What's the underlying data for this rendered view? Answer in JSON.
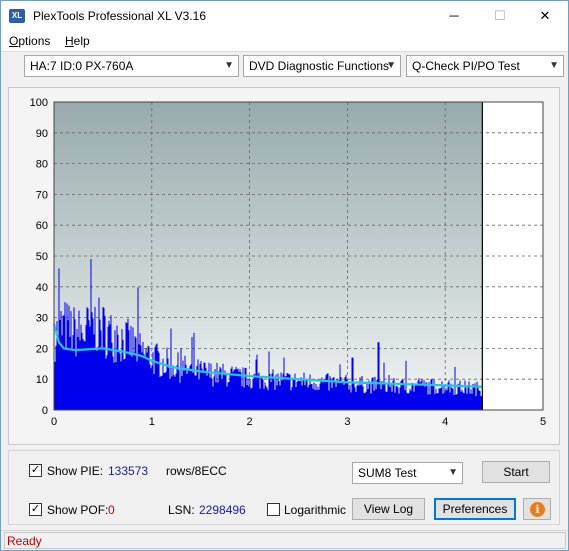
{
  "window": {
    "title": "PlexTools Professional XL V3.16",
    "icon_text": "XL"
  },
  "titlebar_buttons": {
    "minimize": "─",
    "maximize": "☐",
    "close": "✕"
  },
  "menu": [
    {
      "label": "Options",
      "underline": "O",
      "rest": "ptions"
    },
    {
      "label": "Help",
      "underline": "H",
      "rest": "elp"
    }
  ],
  "toolbar": {
    "drive_select": "HA:7 ID:0  PX-760A",
    "function_select": "DVD Diagnostic Functions",
    "test_select": "Q-Check PI/PO Test"
  },
  "chart_data": {
    "type": "area",
    "xlim": [
      0,
      5
    ],
    "ylim": [
      0,
      100
    ],
    "x_ticks": [
      "0",
      "1",
      "2",
      "3",
      "4",
      "5"
    ],
    "y_ticks": [
      "0",
      "10",
      "20",
      "30",
      "40",
      "50",
      "60",
      "70",
      "80",
      "90",
      "100"
    ],
    "grid": true,
    "end_marker_x": 4.38,
    "series": [
      {
        "style": "bars",
        "color": "#0000ee",
        "x": [
          0.0,
          0.1,
          0.2,
          0.3,
          0.4,
          0.5,
          0.6,
          0.7,
          0.8,
          0.9,
          1.0,
          1.2,
          1.4,
          1.6,
          1.8,
          2.0,
          2.5,
          3.0,
          3.5,
          4.0,
          4.38
        ],
        "values": [
          28,
          32,
          30,
          29,
          33,
          31,
          28,
          27,
          25,
          22,
          20,
          17,
          15,
          14,
          13,
          12,
          11,
          10,
          9,
          9,
          8
        ],
        "peaks": [
          {
            "x": 0.05,
            "y": 46
          },
          {
            "x": 0.38,
            "y": 49
          },
          {
            "x": 1.3,
            "y": 20
          },
          {
            "x": 2.2,
            "y": 19
          },
          {
            "x": 3.05,
            "y": 17
          },
          {
            "x": 3.32,
            "y": 22
          },
          {
            "x": 3.6,
            "y": 16
          },
          {
            "x": 4.1,
            "y": 14
          }
        ]
      },
      {
        "style": "line",
        "color": "#1ec8e8",
        "x": [
          0.0,
          0.05,
          0.1,
          0.2,
          0.3,
          0.5,
          0.7,
          0.9,
          1.0,
          1.2,
          1.5,
          2.0,
          2.5,
          3.0,
          3.5,
          4.0,
          4.38
        ],
        "values": [
          28,
          22,
          20,
          19.5,
          19.6,
          20,
          19,
          17.5,
          16,
          14,
          12.5,
          11,
          10,
          9,
          8.5,
          8,
          7.5
        ]
      }
    ]
  },
  "controls": {
    "show_pie_label": "Show PIE:",
    "show_pie_checked": "✓",
    "pie_value": "133573",
    "pie_unit": "rows/8ECC",
    "show_pof_label": "Show POF:",
    "show_pof_checked": "✓",
    "pof_value": "0",
    "lsn_label": "LSN:",
    "lsn_value": "2298496",
    "logarithmic_label": "Logarithmic",
    "sum_select": "SUM8 Test",
    "start_button": "Start",
    "view_log_button": "View Log",
    "preferences_button": "Preferences",
    "info_glyph": "i"
  },
  "status": {
    "text": "Ready"
  },
  "colors": {
    "pie_value": "#1a1aa0",
    "pof_value": "#c00000",
    "status": "#c00000",
    "bars": "#0000ee",
    "avg_line": "#1ec8e8"
  }
}
